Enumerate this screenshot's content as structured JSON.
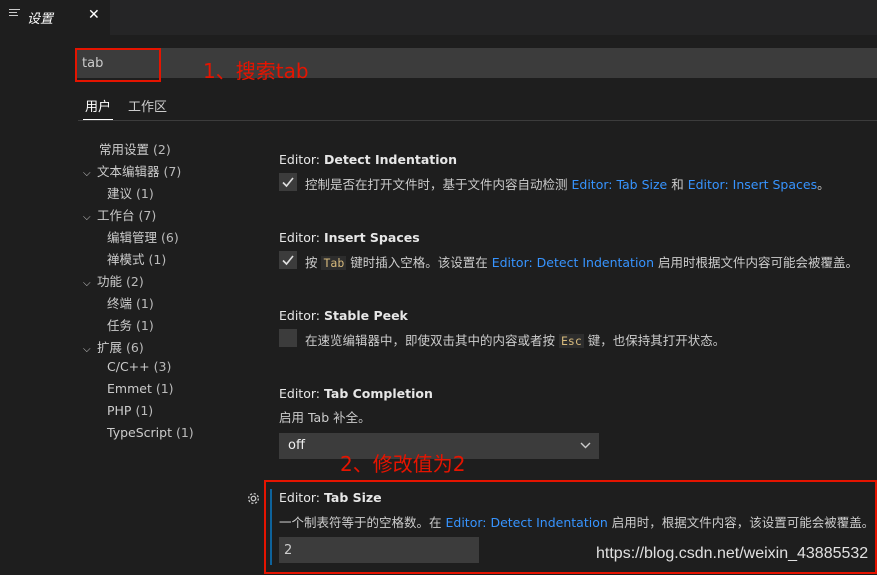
{
  "tab": {
    "title": "设置",
    "close": "✕"
  },
  "search": {
    "value": "tab"
  },
  "annotations": {
    "step1": "1、搜索tab",
    "step2": "2、修改值为2"
  },
  "scope_tabs": [
    "用户",
    "工作区"
  ],
  "toc": [
    {
      "label": "常用设置",
      "count": "(2)"
    },
    {
      "label": "文本编辑器",
      "count": "(7)",
      "chevron": "⌵"
    },
    {
      "label": "建议",
      "count": "(1)"
    },
    {
      "label": "工作台",
      "count": "(7)",
      "chevron": "⌵"
    },
    {
      "label": "编辑管理",
      "count": "(6)"
    },
    {
      "label": "禅模式",
      "count": "(1)"
    },
    {
      "label": "功能",
      "count": "(2)",
      "chevron": "⌵"
    },
    {
      "label": "终端",
      "count": "(1)"
    },
    {
      "label": "任务",
      "count": "(1)"
    },
    {
      "label": "扩展",
      "count": "(6)",
      "chevron": "⌵"
    },
    {
      "label": "C/C++",
      "count": "(3)"
    },
    {
      "label": "Emmet",
      "count": "(1)"
    },
    {
      "label": "PHP",
      "count": "(1)"
    },
    {
      "label": "TypeScript",
      "count": "(1)"
    }
  ],
  "settings": {
    "detect_indentation": {
      "category": "Editor: ",
      "name": "Detect Indentation",
      "desc_before": "控制是否在打开文件时，基于文件内容自动检测 ",
      "link1": "Editor: Tab Size",
      "mid": " 和 ",
      "link2": "Editor: Insert Spaces",
      "desc_after": "。",
      "checked": true
    },
    "insert_spaces": {
      "category": "Editor: ",
      "name": "Insert Spaces",
      "desc_before": "按 ",
      "code": "Tab",
      "desc_mid": " 键时插入空格。该设置在 ",
      "link": "Editor: Detect Indentation",
      "desc_after": " 启用时根据文件内容可能会被覆盖。",
      "checked": true
    },
    "stable_peek": {
      "category": "Editor: ",
      "name": "Stable Peek",
      "desc_before": "在速览编辑器中，即使双击其中的内容或者按 ",
      "code": "Esc",
      "desc_after": " 键，也保持其打开状态。",
      "checked": false
    },
    "tab_completion": {
      "category": "Editor: ",
      "name": "Tab Completion",
      "desc": "启用 Tab 补全。",
      "value": "off"
    },
    "tab_size": {
      "category": "Editor: ",
      "name": "Tab Size",
      "desc_before": "一个制表符等于的空格数。在 ",
      "link": "Editor: Detect Indentation",
      "desc_after": " 启用时，根据文件内容，该设置可能会被覆盖。",
      "value": "2"
    }
  },
  "watermark": "https://blog.csdn.net/weixin_43885532",
  "colors": {
    "accent": "#e51400",
    "link": "#3794ff",
    "background": "#1e1e1e"
  }
}
